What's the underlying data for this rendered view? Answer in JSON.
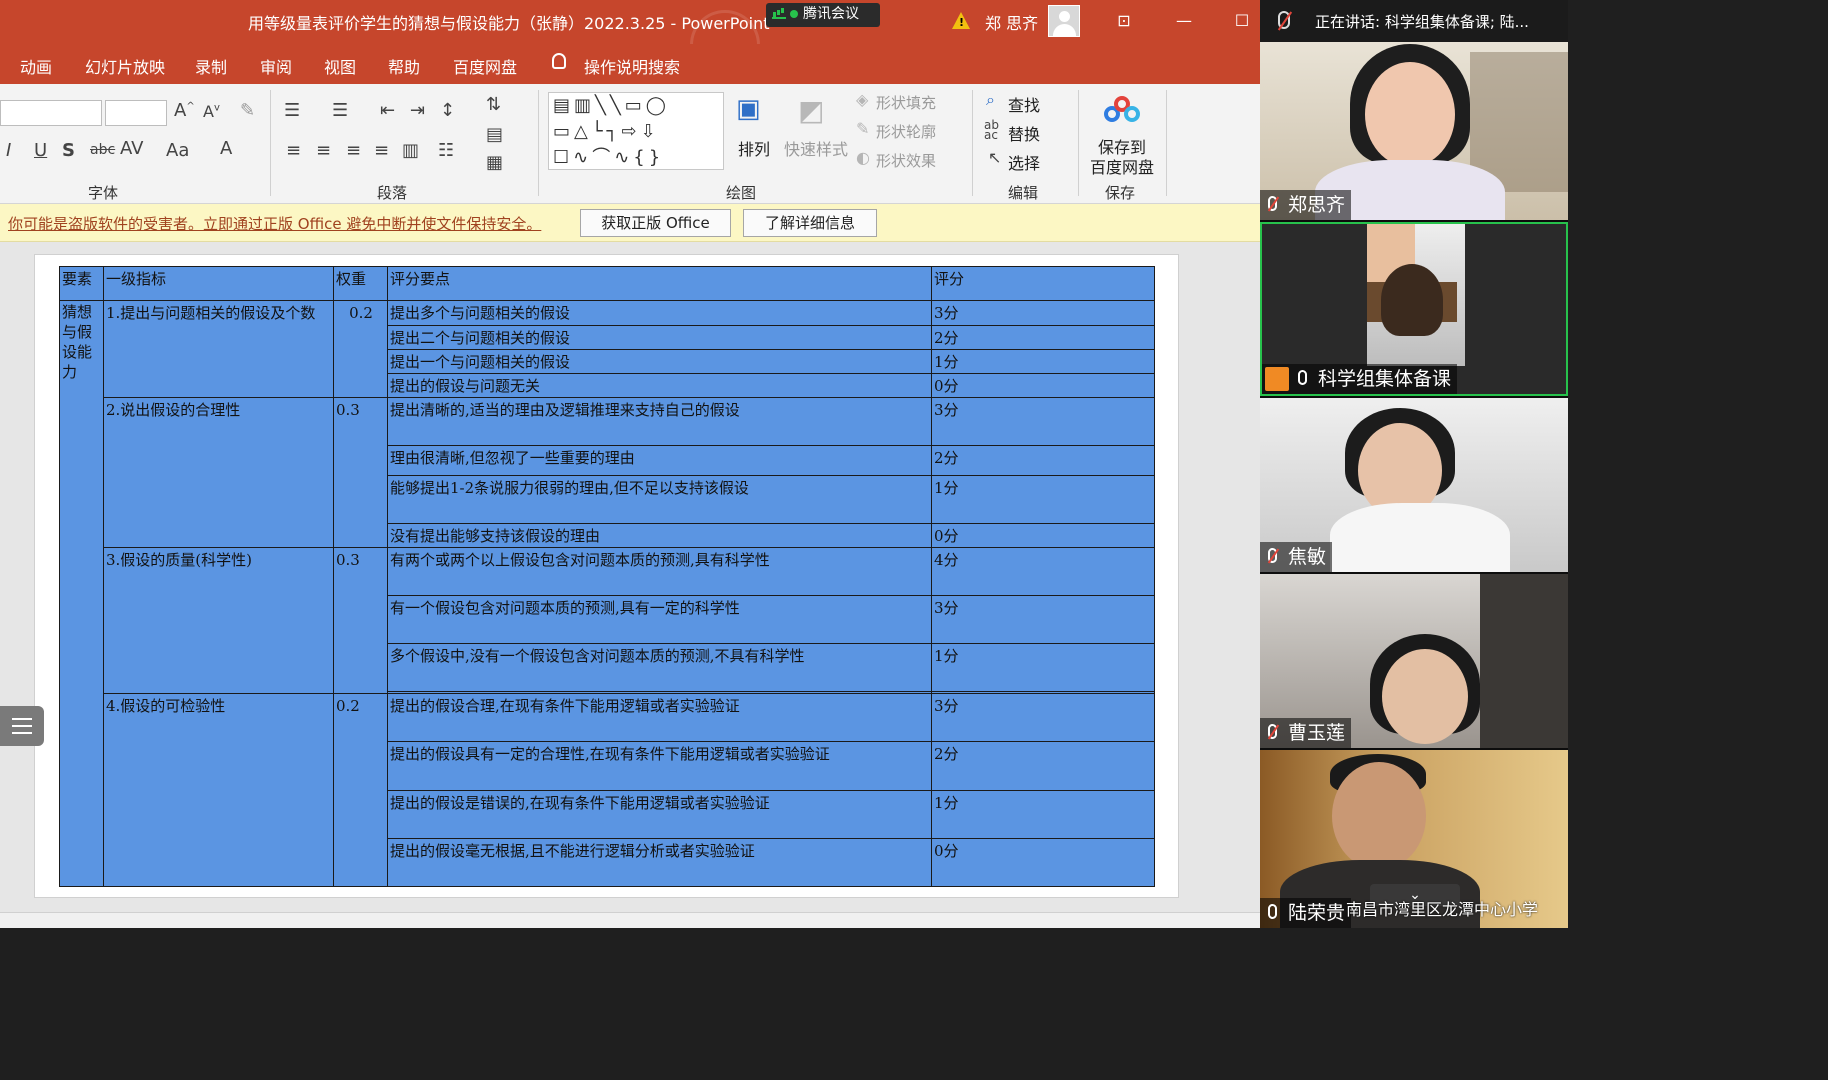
{
  "window": {
    "title": "用等级量表评价学生的猜想与假设能力（张静）2022.3.25  -  PowerPoint",
    "meeting_badge": "腾讯会议",
    "user_name": "郑 思齐",
    "controls": {
      "ribbon_display": "⊡",
      "minimize": "—",
      "maximize": "☐"
    }
  },
  "menu": {
    "items": [
      "动画",
      "幻灯片放映",
      "录制",
      "审阅",
      "视图",
      "帮助",
      "百度网盘"
    ],
    "search_label": "操作说明搜索"
  },
  "ribbon": {
    "groups": {
      "font": "字体",
      "paragraph": "段落",
      "drawing": "绘图",
      "editing": "编辑",
      "save": "保存"
    },
    "drawing": {
      "arrange": "排列",
      "quick_styles": "快速样式",
      "shape_fill": "形状填充",
      "shape_outline": "形状轮廓",
      "shape_effects": "形状效果"
    },
    "editing": {
      "find": "查找",
      "replace": "替换",
      "select": "选择"
    },
    "save": {
      "label_line1": "保存到",
      "label_line2": "百度网盘"
    }
  },
  "notice": {
    "text": "你可能是盗版软件的受害者。立即通过正版 Office 避免中断并使文件保持安全。",
    "get_genuine": "获取正版 Office",
    "learn_more": "了解详细信息"
  },
  "slide_table": {
    "headers": [
      "要素",
      "一级指标",
      "权重",
      "评分要点",
      "评分"
    ],
    "element": "猜想与假设能力",
    "indicators": [
      {
        "name": "1.提出与问题相关的假设及个数",
        "weight": "0.2",
        "points": [
          {
            "text": "提出多个与问题相关的假设",
            "score": "3分"
          },
          {
            "text": "提出二个与问题相关的假设",
            "score": "2分"
          },
          {
            "text": "提出一个与问题相关的假设",
            "score": "1分"
          },
          {
            "text": "提出的假设与问题无关",
            "score": "0分"
          }
        ]
      },
      {
        "name": "2.说出假设的合理性",
        "weight": "0.3",
        "points": [
          {
            "text": "提出清晰的,适当的理由及逻辑推理来支持自己的假设",
            "score": "3分"
          },
          {
            "text": "理由很清晰,但忽视了一些重要的理由",
            "score": "2分"
          },
          {
            "text": "能够提出1-2条说服力很弱的理由,但不足以支持该假设",
            "score": "1分"
          },
          {
            "text": "没有提出能够支持该假设的理由",
            "score": "0分"
          }
        ]
      },
      {
        "name": "3.假设的质量(科学性)",
        "weight": "0.3",
        "points": [
          {
            "text": "有两个或两个以上假设包含对问题本质的预测,具有科学性",
            "score": "4分"
          },
          {
            "text": "有一个假设包含对问题本质的预测,具有一定的科学性",
            "score": "3分"
          },
          {
            "text": "多个假设中,没有一个假设包含对问题本质的预测,不具有科学性",
            "score": "1分"
          }
        ]
      },
      {
        "name": "4.假设的可检验性",
        "weight": "0.2",
        "points": [
          {
            "text": "提出的假设合理,在现有条件下能用逻辑或者实验验证",
            "score": "3分"
          },
          {
            "text": "提出的假设具有一定的合理性,在现有条件下能用逻辑或者实验验证",
            "score": "2分"
          },
          {
            "text": "提出的假设是错误的,在现有条件下能用逻辑或者实验验证",
            "score": "1分"
          },
          {
            "text": "提出的假设毫无根据,且不能进行逻辑分析或者实验验证",
            "score": "0分"
          }
        ]
      }
    ]
  },
  "meeting": {
    "speaking": "正在讲话: 科学组集体备课; 陆...",
    "participants": [
      {
        "name": "郑思齐",
        "mic": "muted"
      },
      {
        "name": "科学组集体备课",
        "mic": "on"
      },
      {
        "name": "焦敏",
        "mic": "muted"
      },
      {
        "name": "曹玉莲",
        "mic": "muted"
      },
      {
        "name": "陆荣贵",
        "mic": "on"
      }
    ],
    "watermark": "南昌市湾里区龙潭中心小学"
  },
  "colors": {
    "ppt_accent": "#c6462c",
    "table_fill": "#5b95e2",
    "active_speaker": "#27c24c",
    "notice_bg": "#fcf7c4"
  }
}
